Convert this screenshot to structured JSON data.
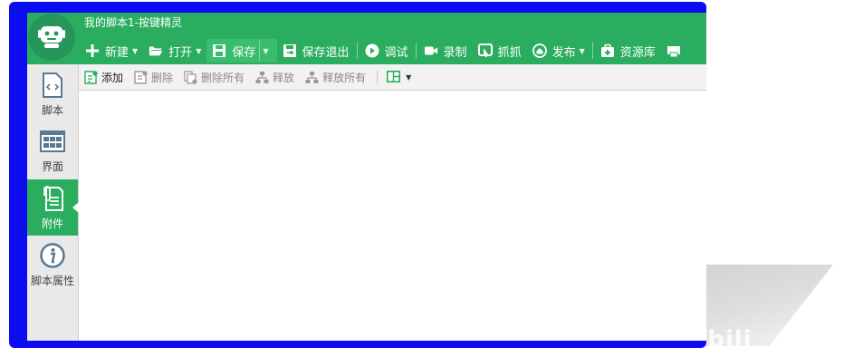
{
  "window": {
    "title": "我的脚本1-按键精灵"
  },
  "toolbar": {
    "new_label": "新建",
    "open_label": "打开",
    "save_label": "保存",
    "save_exit_label": "保存退出",
    "debug_label": "调试",
    "record_label": "录制",
    "capture_label": "抓抓",
    "publish_label": "发布",
    "resources_label": "资源库"
  },
  "sidebar": {
    "items": [
      {
        "label": "脚本",
        "icon": "script-icon"
      },
      {
        "label": "界面",
        "icon": "interface-icon"
      },
      {
        "label": "附件",
        "icon": "attachment-icon"
      },
      {
        "label": "脚本属性",
        "icon": "info-icon"
      }
    ],
    "active_index": 2
  },
  "subtoolbar": {
    "add_label": "添加",
    "delete_label": "删除",
    "delete_all_label": "删除所有",
    "release_label": "释放",
    "release_all_label": "释放所有"
  },
  "colors": {
    "brand_green": "#2aad5f",
    "frame_blue": "#0c0cf0"
  },
  "watermark": "bilibili"
}
